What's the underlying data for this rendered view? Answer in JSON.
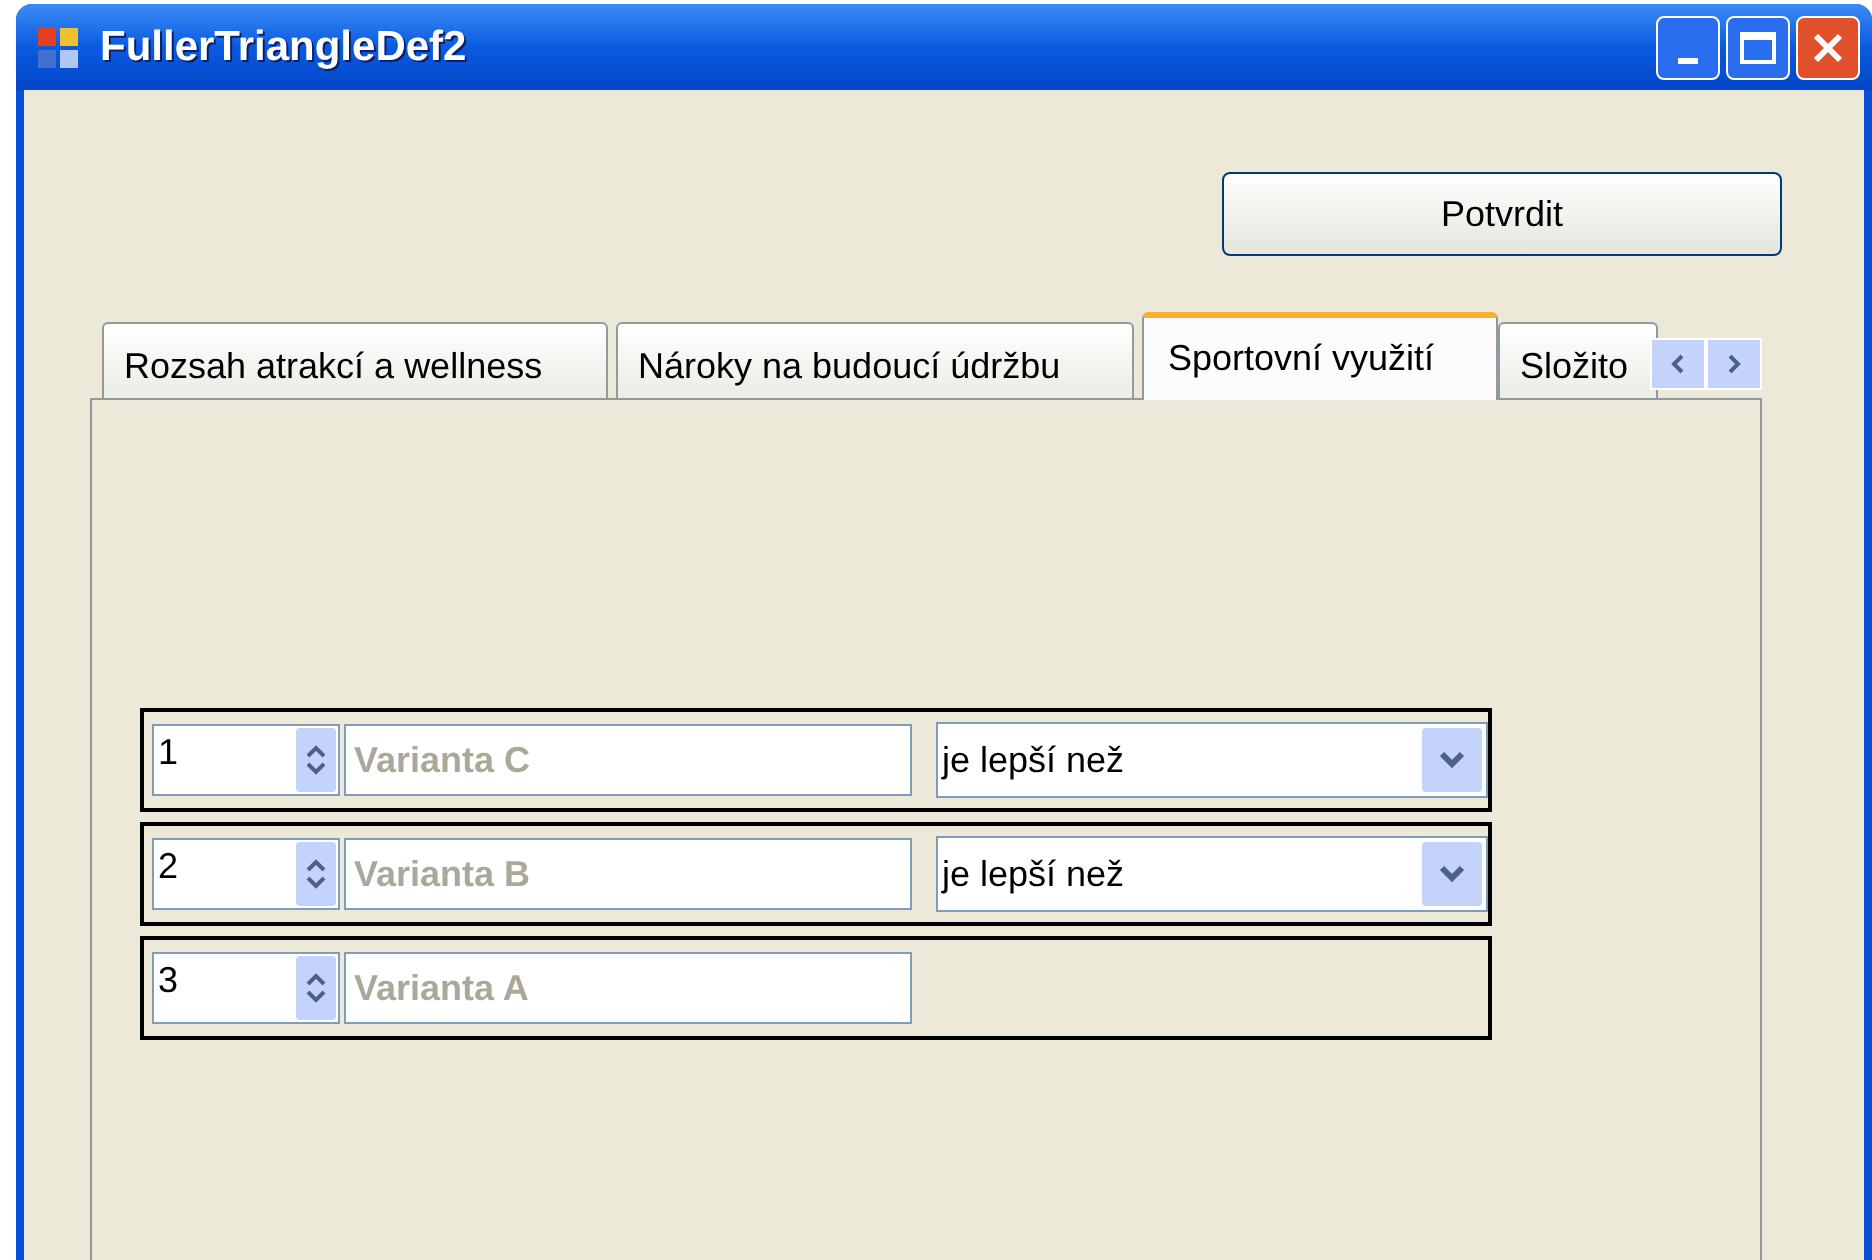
{
  "window": {
    "title": "FullerTriangleDef2"
  },
  "confirm_button": "Potvrdit",
  "tabs": [
    {
      "label": "Rozsah atrakcí a wellness",
      "selected": false
    },
    {
      "label": "Nároky na budoucí údržbu",
      "selected": false
    },
    {
      "label": "Sportovní využití",
      "selected": true
    },
    {
      "label": "Složito",
      "selected": false
    }
  ],
  "rows": [
    {
      "rank": "1",
      "variant": "Varianta C",
      "disabled": true,
      "relation": "je lepší než"
    },
    {
      "rank": "2",
      "variant": "Varianta B",
      "disabled": true,
      "relation": "je lepší než"
    },
    {
      "rank": "3",
      "variant": "Varianta A",
      "disabled": true
    }
  ]
}
